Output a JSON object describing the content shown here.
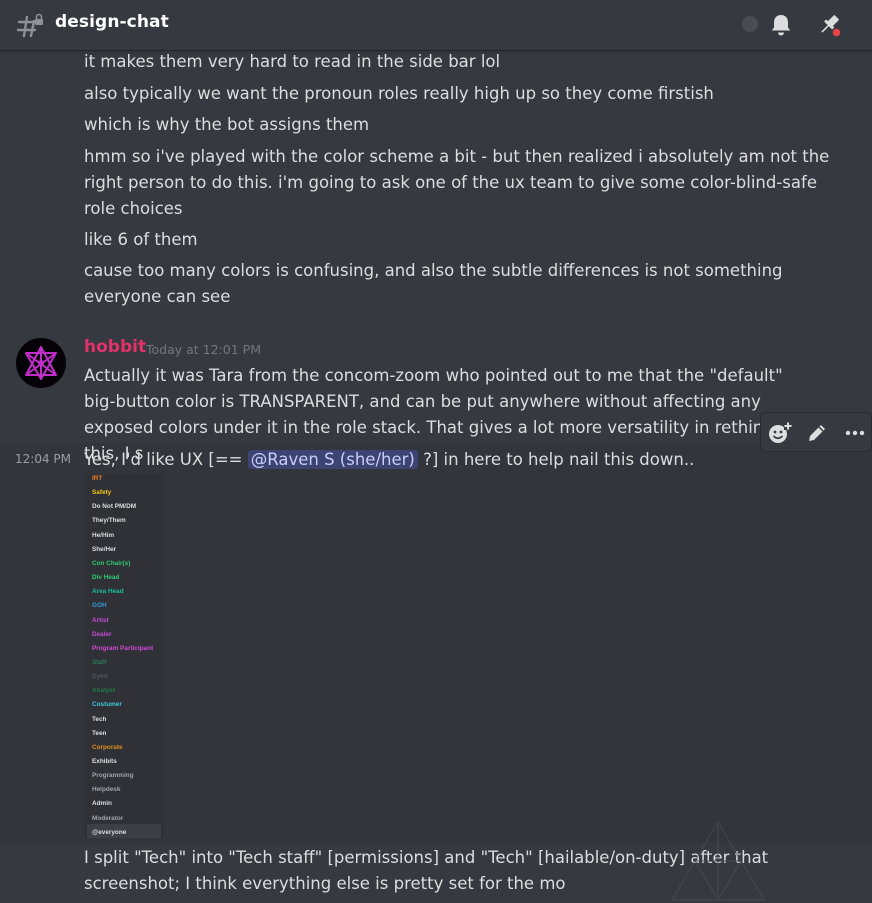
{
  "header": {
    "channel_name": "design-chat",
    "icons": [
      "hash-lock-icon",
      "bell-icon",
      "pin-icon"
    ]
  },
  "messages": {
    "previous_lines": [
      "it makes them very hard to read in the side bar lol",
      "also typically we want the pronoun roles really high up so they come firstish",
      "which is why the bot assigns them",
      "hmm so i've played with the color scheme a bit - but then realized i absolutely am not the right person to do this. i'm going to ask one of the ux team to give some color-blind-safe role choices",
      "like 6 of them",
      "cause too many colors is confusing, and also the subtle differences is not something everyone can see"
    ],
    "hobbit": {
      "username": "hobbit",
      "username_color": "#e3326a",
      "timestamp": "Today at 12:01 PM",
      "text": "Actually it was Tara from the concom-zoom who pointed out to me that the \"default\" big-button color is TRANSPARENT, and can be put anywhere without affecting any exposed colors under it in the role stack.  That gives a lot more versatility in rethinking this, I s",
      "followup_time": "12:04 PM",
      "followup_before": "Yes, I'd like UX [== ",
      "mention": "@Raven S (she/her)",
      "followup_after": " ?]  in here to help nail this down..",
      "last_message": "I split \"Tech\" into \"Tech staff\" [permissions] and \"Tech\" [hailable/on-duty] after that screenshot; I think everything else is pretty set for the mo"
    }
  },
  "toolbar": [
    "add-reaction-icon",
    "edit-icon",
    "more-icon"
  ],
  "roles_screenshot": [
    {
      "label": "IRT",
      "color": "#e67e22"
    },
    {
      "label": "Safety",
      "color": "#f1c40f"
    },
    {
      "label": "Do Not PM/DM",
      "color": "#dcddde"
    },
    {
      "label": "They/Them",
      "color": "#dcddde"
    },
    {
      "label": "He/Him",
      "color": "#dcddde"
    },
    {
      "label": "She/Her",
      "color": "#dcddde"
    },
    {
      "label": "Con Chair(s)",
      "color": "#2ecc71"
    },
    {
      "label": "Div Head",
      "color": "#2ecc71"
    },
    {
      "label": "Area Head",
      "color": "#1abc9c"
    },
    {
      "label": "GOH",
      "color": "#3498db"
    },
    {
      "label": "Artist",
      "color": "#c44bd6"
    },
    {
      "label": "Dealer",
      "color": "#c44bd6"
    },
    {
      "label": "Program Participant",
      "color": "#d24bd6"
    },
    {
      "label": "Staff",
      "color": "#2b7a5a"
    },
    {
      "label": "Dyed",
      "color": "#50545a"
    },
    {
      "label": "Analyst",
      "color": "#1f7a46"
    },
    {
      "label": "Costumer",
      "color": "#3fc9e0"
    },
    {
      "label": "Tech",
      "color": "#dcddde"
    },
    {
      "label": "Teen",
      "color": "#dcddde"
    },
    {
      "label": "Corporate",
      "color": "#e08a1e"
    },
    {
      "label": "Exhibits",
      "color": "#dcddde"
    },
    {
      "label": "Programming",
      "color": "#a0a4aa"
    },
    {
      "label": "Helpdesk",
      "color": "#a0a4aa"
    },
    {
      "label": "Admin",
      "color": "#dcddde"
    },
    {
      "label": "Moderator",
      "color": "#a0a4aa"
    },
    {
      "label": "@everyone",
      "color": "#dcddde"
    }
  ]
}
